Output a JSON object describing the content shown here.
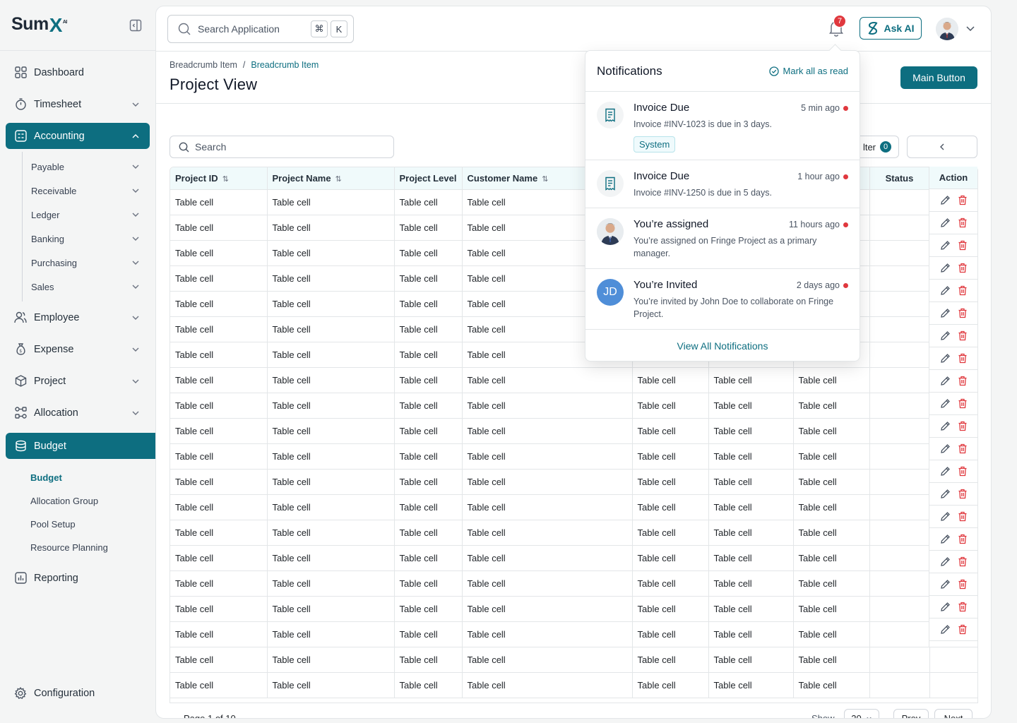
{
  "brand": {
    "logo_main": "Sum",
    "logo_x": "X",
    "logo_ai": "AI"
  },
  "sidebar": {
    "items": [
      {
        "label": "Dashboard"
      },
      {
        "label": "Timesheet"
      },
      {
        "label": "Accounting"
      },
      {
        "label": "Employee"
      },
      {
        "label": "Expense"
      },
      {
        "label": "Project"
      },
      {
        "label": "Allocation"
      },
      {
        "label": "Budget"
      },
      {
        "label": "Reporting"
      },
      {
        "label": "Configuration"
      }
    ],
    "accounting_sub": [
      "Payable",
      "Receivable",
      "Ledger",
      "Banking",
      "Purchasing",
      "Sales"
    ],
    "budget_sub": [
      "Budget",
      "Allocation Group",
      "Pool Setup",
      "Resource Planning"
    ]
  },
  "topbar": {
    "search_placeholder": "Search Application",
    "kbd_cmd": "⌘",
    "kbd_k": "K",
    "notification_count": "7",
    "ask_ai": "Ask AI"
  },
  "header": {
    "breadcrumb": [
      "Breadcrumb Item",
      "Breadcrumb Item"
    ],
    "breadcrumb_sep": "/",
    "title": "Project View",
    "main_button": "Main Button"
  },
  "toolbar": {
    "search_placeholder": "Search",
    "filter_label": "lter",
    "filter_count": "0",
    "arrow": "‹"
  },
  "table": {
    "columns": [
      "Project ID",
      "Project Name",
      "Project Level",
      "Customer Name",
      "",
      "",
      "",
      "Status",
      "Action"
    ],
    "cell_text": "Table cell",
    "row_count": 20
  },
  "pagination": {
    "page_text": "Page 1 of 10",
    "show_label": "Show",
    "page_size": "20",
    "prev": "Prev",
    "next": "Next"
  },
  "notifications": {
    "title": "Notifications",
    "mark_all": "Mark all as read",
    "items": [
      {
        "title": "Invoice Due",
        "time": "5 min ago",
        "body": "Invoice #INV-1023 is due in 3 days.",
        "tag": "System",
        "icon": "receipt-icon"
      },
      {
        "title": "Invoice Due",
        "time": "1 hour ago",
        "body": "Invoice #INV-1250 is due in 5 days.",
        "icon": "receipt-icon"
      },
      {
        "title": "You’re assigned",
        "time": "11 hours ago",
        "body": "You’re assigned on Fringe Project as a primary manager.",
        "icon": "user-photo"
      },
      {
        "title": "You’re Invited",
        "time": "2 days ago",
        "body": "You’re invited by John Doe to collaborate on Fringe Project.",
        "initials": "JD"
      }
    ],
    "view_all": "View All Notifications"
  },
  "colors": {
    "accent": "#0d6e80",
    "danger": "#e0383e",
    "header_bg": "#f0fafb"
  }
}
